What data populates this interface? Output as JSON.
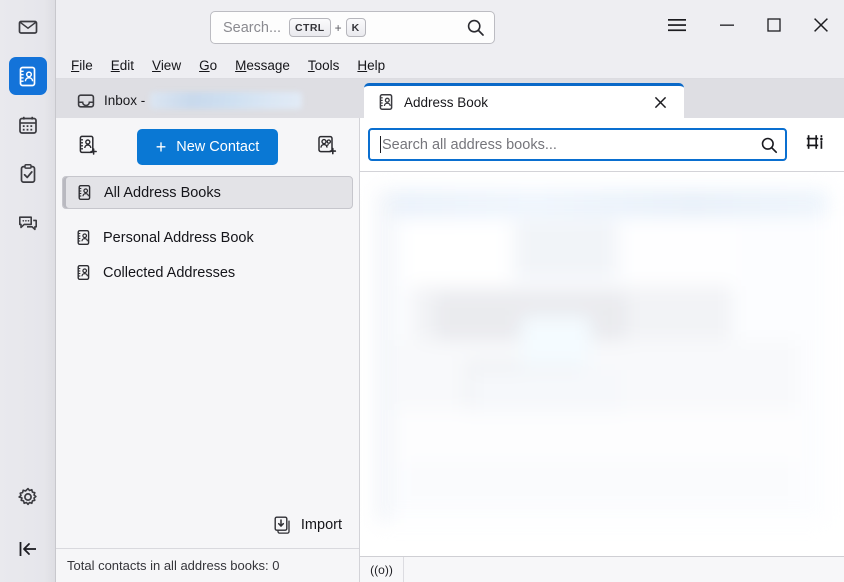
{
  "app": {
    "accent_blue": "#0a78d4",
    "tab_indicator_blue": "#0a69c8",
    "focus_blue": "#0a6fd0"
  },
  "spaces": {
    "items": [
      {
        "name": "mail",
        "label": "Mail",
        "active": false
      },
      {
        "name": "address-book",
        "label": "Address Book",
        "active": true
      },
      {
        "name": "calendar",
        "label": "Calendar",
        "active": false
      },
      {
        "name": "tasks",
        "label": "Tasks",
        "active": false
      },
      {
        "name": "chat",
        "label": "Chat",
        "active": false
      }
    ],
    "bottom": [
      {
        "name": "settings",
        "label": "Settings"
      },
      {
        "name": "collapse",
        "label": "Collapse"
      }
    ]
  },
  "titlebar": {
    "search": {
      "placeholder": "Search...",
      "key1": "CTRL",
      "plus": "+",
      "key2": "K"
    },
    "controls": {
      "app_menu": "App Menu",
      "minimize": "Minimize",
      "maximize": "Maximize",
      "close": "Close"
    }
  },
  "menubar": {
    "items": [
      {
        "access": "F",
        "rest": "ile"
      },
      {
        "access": "E",
        "rest": "dit"
      },
      {
        "access": "V",
        "rest": "iew"
      },
      {
        "access": "G",
        "rest": "o"
      },
      {
        "access": "M",
        "rest": "essage"
      },
      {
        "access": "T",
        "rest": "ools"
      },
      {
        "access": "H",
        "rest": "elp"
      }
    ]
  },
  "tabs": [
    {
      "label": "Inbox - ",
      "redacted": true,
      "active": false,
      "closable": false
    },
    {
      "label": "Address Book",
      "redacted": false,
      "active": true,
      "closable": true
    }
  ],
  "address_book_pane": {
    "toolbar": {
      "new_address_book": "New Address Book",
      "new_contact_label": "New Contact",
      "new_contact_plus": "+",
      "new_contact_list": "New Contact List"
    },
    "books": [
      {
        "label": "All Address Books",
        "selected": true
      },
      {
        "label": "Personal Address Book",
        "selected": false
      },
      {
        "label": "Collected Addresses",
        "selected": false
      }
    ],
    "import_label": "Import",
    "status": "Total contacts in all address books: 0"
  },
  "main_pane": {
    "search_placeholder": "Search all address books...",
    "display_options": "Display Options"
  },
  "window_status": {
    "connection": "((o))"
  }
}
